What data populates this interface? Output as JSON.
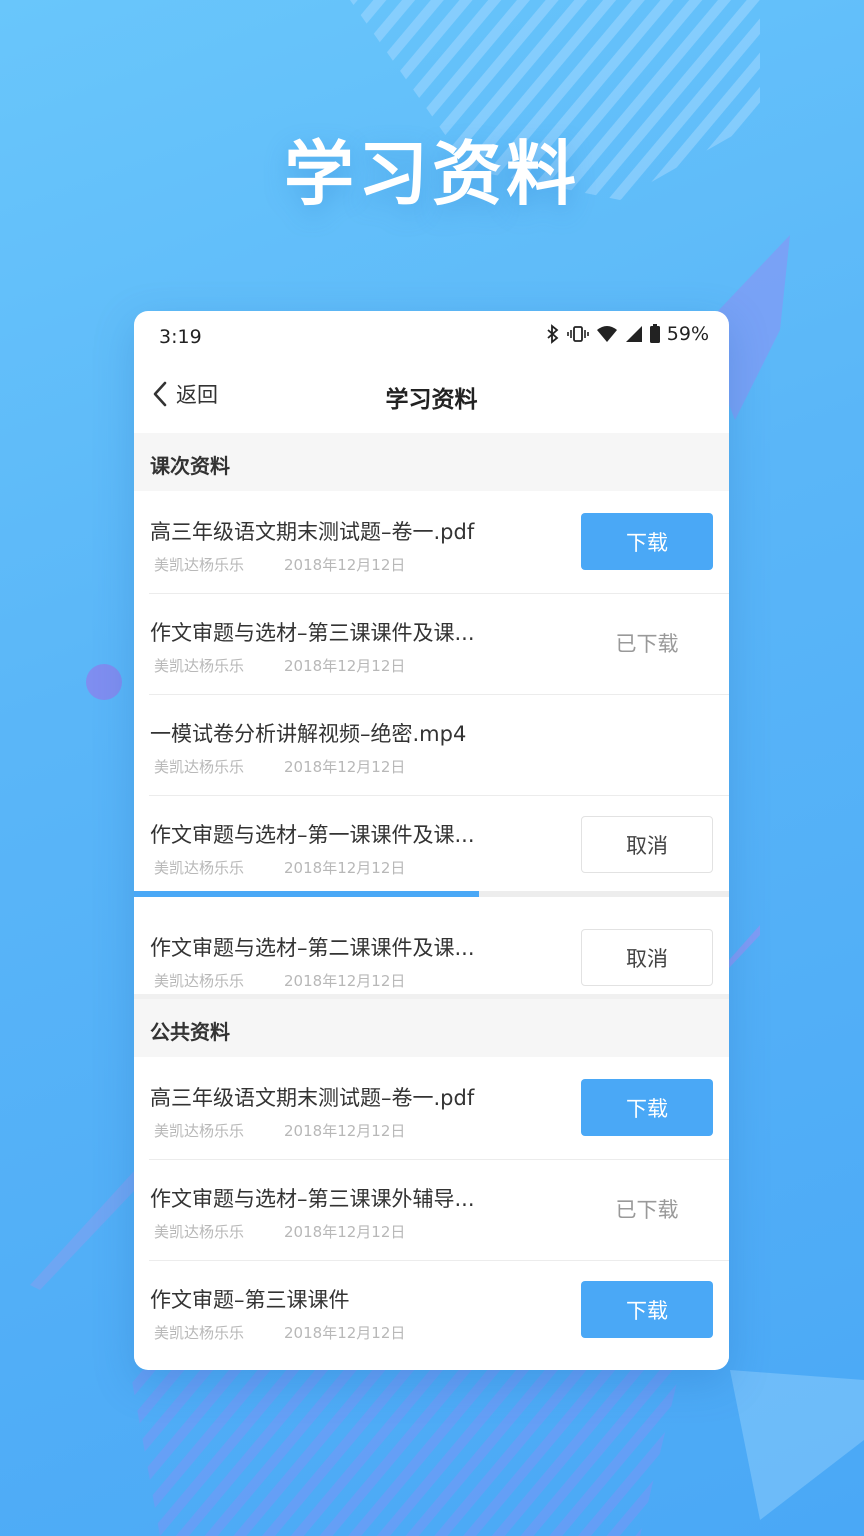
{
  "hero_title": "学习资料",
  "status_bar": {
    "time": "3:19",
    "battery": "59%"
  },
  "nav": {
    "back_label": "返回",
    "title": "学习资料"
  },
  "sections": [
    {
      "label": "课次资料",
      "items": [
        {
          "name": "高三年级语文期末测试题–卷一.pdf",
          "author": "美凯达杨乐乐",
          "date": "2018年12月12日",
          "action": "下载",
          "action_style": "primary"
        },
        {
          "name": "作文审题与选材–第三课课件及课...",
          "author": "美凯达杨乐乐",
          "date": "2018年12月12日",
          "action": "已下载",
          "action_style": "text"
        },
        {
          "name": "一模试卷分析讲解视频–绝密.mp4",
          "author": "美凯达杨乐乐",
          "date": "2018年12月12日",
          "action": "",
          "action_style": "none"
        },
        {
          "name": "作文审题与选材–第一课课件及课...",
          "author": "美凯达杨乐乐",
          "date": "2018年12月12日",
          "action": "取消",
          "action_style": "outline",
          "progress": 0.58
        },
        {
          "name": "作文审题与选材–第二课课件及课...",
          "author": "美凯达杨乐乐",
          "date": "2018年12月12日",
          "action": "取消",
          "action_style": "outline"
        }
      ]
    },
    {
      "label": "公共资料",
      "items": [
        {
          "name": "高三年级语文期末测试题–卷一.pdf",
          "author": "美凯达杨乐乐",
          "date": "2018年12月12日",
          "action": "下载",
          "action_style": "primary"
        },
        {
          "name": "作文审题与选材–第三课课外辅导...",
          "author": "美凯达杨乐乐",
          "date": "2018年12月12日",
          "action": "已下载",
          "action_style": "text"
        },
        {
          "name": "作文审题–第三课课件",
          "author": "美凯达杨乐乐",
          "date": "2018年12月12日",
          "action": "下载",
          "action_style": "primary"
        }
      ]
    }
  ],
  "colors": {
    "accent": "#4aa8f6",
    "background": "#5ab6f8"
  }
}
